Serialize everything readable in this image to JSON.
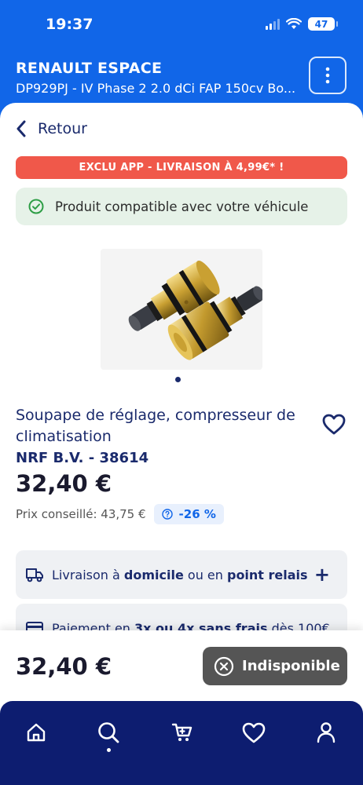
{
  "status_bar": {
    "time": "19:37",
    "battery": "47"
  },
  "vehicle": {
    "title": "RENAULT ESPACE",
    "subtitle": "DP929PJ - IV Phase 2 2.0 dCi FAP 150cv Bo..."
  },
  "nav": {
    "back_label": "Retour"
  },
  "promo": {
    "text": "EXCLU APP - LIVRAISON À 4,99€* !"
  },
  "compatibility": {
    "text": "Produit compatible avec votre véhicule"
  },
  "product": {
    "name": "Soupape de réglage, compresseur de climatisation",
    "reference": "NRF B.V. - 38614",
    "price": "32,40 €",
    "recommended_price_label": "Prix conseillé: 43,75 €",
    "discount": "-26 %"
  },
  "delivery": {
    "prefix": "Livraison à ",
    "bold1": "domicile",
    "middle": " ou en ",
    "bold2": "point relais",
    "expand": "+"
  },
  "payment": {
    "prefix": "Paiement en ",
    "bold": "3x ou 4x sans frais",
    "suffix": " dès 100€"
  },
  "buy_bar": {
    "price": "32,40 €",
    "unavailable_label": "Indisponible"
  },
  "bottom_nav": {
    "items": [
      "home-icon",
      "search-icon",
      "cart-icon",
      "heart-icon",
      "user-icon"
    ],
    "active": "search-icon"
  },
  "colors": {
    "brand_blue": "#1166e8",
    "navy": "#0d1d70",
    "promo_red": "#f0584a",
    "compat_green": "#2e9e46",
    "unavailable_gray": "#555555"
  }
}
